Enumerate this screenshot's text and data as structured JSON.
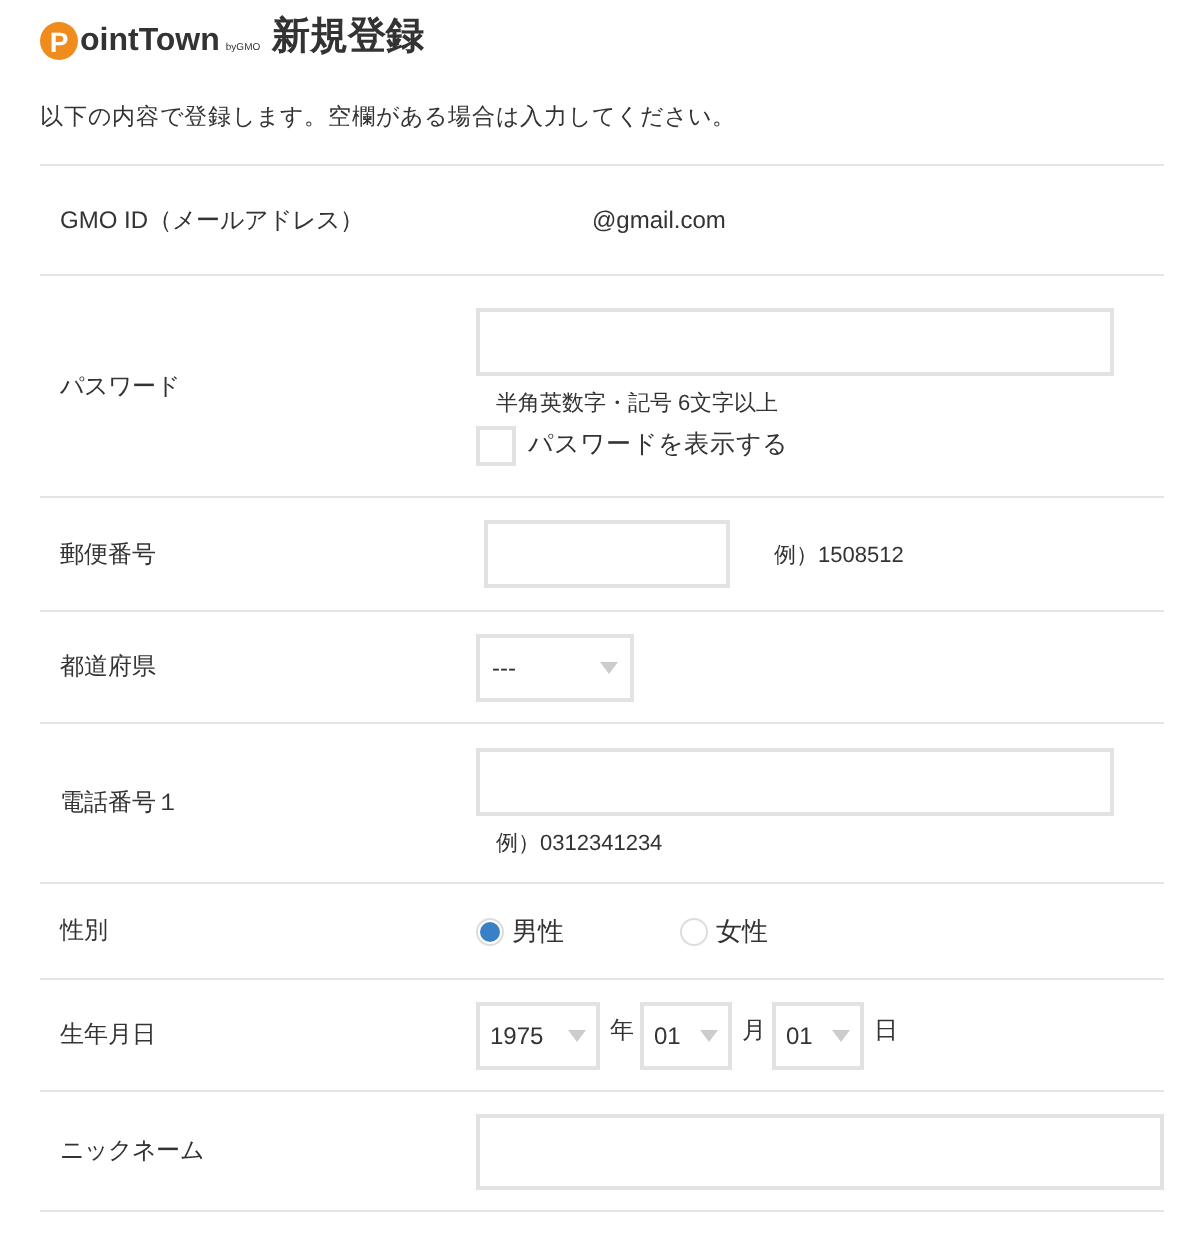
{
  "header": {
    "logo": {
      "mark": "P",
      "name": "ointTown",
      "by": "byGMO"
    },
    "title": "新規登録"
  },
  "intro": "以下の内容で登録します。空欄がある場合は入力してください。",
  "rows": [
    {
      "kind": "text",
      "label": "GMO ID（メールアドレス）",
      "value": "@gmail.com"
    },
    {
      "kind": "password",
      "label": "パスワード",
      "note": "半角英数字・記号 6文字以上",
      "toggle": {
        "label": "パスワードを表示する",
        "checked": false
      }
    },
    {
      "kind": "postal",
      "label": "郵便番号",
      "example": "例）1508512"
    },
    {
      "kind": "select",
      "label": "都道府県",
      "value": "---"
    },
    {
      "kind": "phone",
      "label": "電話番号１",
      "example": "例）0312341234"
    },
    {
      "kind": "radio",
      "label": "性別",
      "options": [
        {
          "label": "男性",
          "selected": true
        },
        {
          "label": "女性",
          "selected": false
        }
      ]
    },
    {
      "kind": "date",
      "label": "生年月日",
      "parts": [
        {
          "value": "1975",
          "unit": "年"
        },
        {
          "value": "01",
          "unit": "月"
        },
        {
          "value": "01",
          "unit": "日"
        }
      ]
    },
    {
      "kind": "field",
      "label": "ニックネーム"
    }
  ]
}
